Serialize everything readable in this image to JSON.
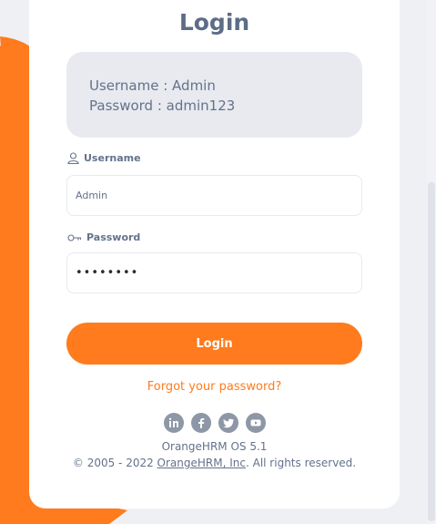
{
  "page": {
    "title": "Login"
  },
  "credentials": {
    "username_line": "Username : Admin",
    "password_line": "Password : admin123"
  },
  "form": {
    "username_label": "Username",
    "username_value": "Admin",
    "password_label": "Password",
    "password_value": "••••••••"
  },
  "actions": {
    "login_label": "Login",
    "forgot_label": "Forgot your password?"
  },
  "social": {
    "icons": [
      "linkedin-icon",
      "facebook-icon",
      "twitter-icon",
      "youtube-icon"
    ]
  },
  "footer": {
    "version": "OrangeHRM OS 5.1",
    "copyright_prefix": "© 2005 - 2022 ",
    "company_link": "OrangeHRM, Inc",
    "copyright_suffix": ". All rights reserved."
  },
  "colors": {
    "accent": "#ff7b1d",
    "text": "#64728c",
    "background": "#eef0f4",
    "card": "#ffffff",
    "credentials_box": "#e8eaef"
  }
}
